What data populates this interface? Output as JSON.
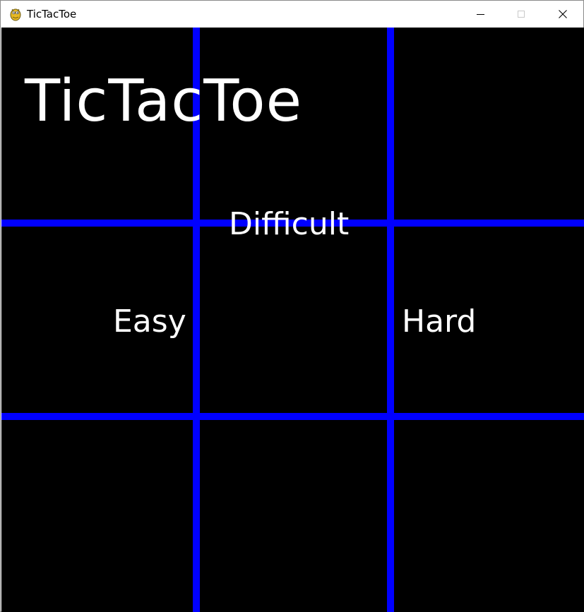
{
  "window": {
    "title": "TicTacToe",
    "app_icon": "pygame-snake-icon",
    "controls": {
      "minimize_icon": "minimize-icon",
      "maximize_icon": "maximize-icon",
      "close_icon": "close-icon"
    }
  },
  "game": {
    "title": "TicTacToe",
    "menu": {
      "difficulty_label": "Difficult",
      "easy_label": "Easy",
      "hard_label": "Hard"
    },
    "colors": {
      "background": "#000000",
      "grid": "#0000ff",
      "text": "#ffffff"
    },
    "board": {
      "rows": 3,
      "cols": 3
    }
  }
}
